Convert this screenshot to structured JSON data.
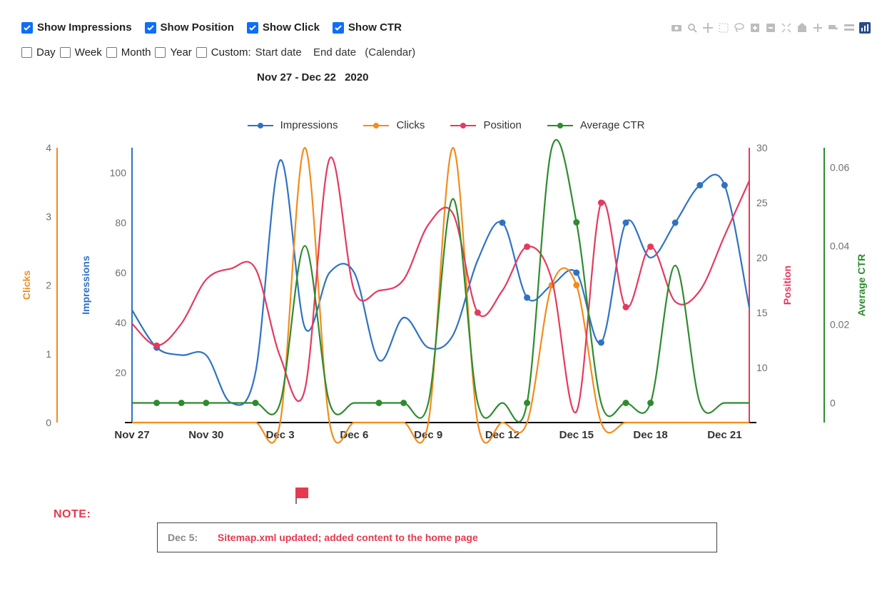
{
  "toggles": {
    "impressions": "Show Impressions",
    "position": "Show Position",
    "click": "Show Click",
    "ctr": "Show CTR"
  },
  "range": {
    "day": "Day",
    "week": "Week",
    "month": "Month",
    "year": "Year",
    "custom": "Custom:",
    "start": "Start date",
    "end": "End date",
    "calendar": "(Calendar)"
  },
  "title": {
    "range": "Nov 27 - Dec 22",
    "year": "2020"
  },
  "legend": {
    "impressions": "Impressions",
    "clicks": "Clicks",
    "position": "Position",
    "ctr": "Average  CTR"
  },
  "axes": {
    "clicks_label": "Clicks",
    "impressions_label": "Impressions",
    "position_label": "Position",
    "ctr_label": "Average  CTR",
    "clicks_ticks": [
      "0",
      "1",
      "2",
      "3",
      "4"
    ],
    "impressions_ticks": [
      "20",
      "40",
      "60",
      "80",
      "100"
    ],
    "position_ticks": [
      "10",
      "15",
      "20",
      "25",
      "30"
    ],
    "ctr_ticks": [
      "0",
      "0.02",
      "0.04",
      "0.06"
    ],
    "x_ticks": [
      "Nov 27",
      "Nov 30",
      "Dec 3",
      "Dec 6",
      "Dec 9",
      "Dec 12",
      "Dec 15",
      "Dec 18",
      "Dec 21"
    ]
  },
  "note": {
    "label": "NOTE:",
    "date": "Dec 5:",
    "text": "Sitemap.xml updated; added content to the home page"
  },
  "colors": {
    "impressions": "#2f72c3",
    "clicks": "#f28c1b",
    "position": "#e6395e",
    "ctr": "#2e8b2e"
  },
  "chart_data": {
    "type": "line",
    "title": "Nov 27 - Dec 22  2020",
    "x": [
      "Nov 27",
      "Nov 28",
      "Nov 29",
      "Nov 30",
      "Dec 1",
      "Dec 2",
      "Dec 3",
      "Dec 4",
      "Dec 5",
      "Dec 6",
      "Dec 7",
      "Dec 8",
      "Dec 9",
      "Dec 10",
      "Dec 11",
      "Dec 12",
      "Dec 13",
      "Dec 14",
      "Dec 15",
      "Dec 16",
      "Dec 17",
      "Dec 18",
      "Dec 19",
      "Dec 20",
      "Dec 21",
      "Dec 22"
    ],
    "axes": {
      "impressions": {
        "range": [
          0,
          110
        ],
        "side": "left-inner"
      },
      "clicks": {
        "range": [
          0,
          4
        ],
        "side": "left-outer"
      },
      "position": {
        "range": [
          5,
          30
        ],
        "side": "right-inner"
      },
      "ctr": {
        "range": [
          -0.005,
          0.065
        ],
        "side": "right-outer"
      }
    },
    "series": [
      {
        "name": "Impressions",
        "axis": "impressions",
        "values": [
          45,
          30,
          27,
          27,
          8,
          20,
          105,
          38,
          60,
          60,
          25,
          42,
          30,
          35,
          65,
          80,
          50,
          55,
          60,
          32,
          80,
          66,
          80,
          95,
          95,
          46
        ]
      },
      {
        "name": "Clicks",
        "axis": "clicks",
        "values": [
          0,
          0,
          0,
          0,
          0,
          0,
          0,
          4,
          0,
          0,
          0,
          0,
          0,
          4,
          0,
          0,
          0,
          2,
          2,
          0,
          0,
          0,
          0,
          0,
          0,
          0
        ]
      },
      {
        "name": "Position",
        "axis": "position",
        "values": [
          14,
          12,
          14,
          18,
          19,
          19,
          11,
          8,
          29,
          17,
          17,
          18,
          23,
          24,
          15,
          17,
          21,
          18,
          6,
          25,
          15.5,
          21,
          16,
          17,
          22,
          27
        ]
      },
      {
        "name": "Average CTR",
        "axis": "ctr",
        "values": [
          0,
          0,
          0,
          0,
          0,
          0,
          0,
          0.04,
          0,
          0,
          0,
          0,
          0,
          0.052,
          0,
          0,
          0,
          0.065,
          0.046,
          0,
          0,
          0,
          0.035,
          0,
          0,
          0
        ]
      }
    ]
  }
}
